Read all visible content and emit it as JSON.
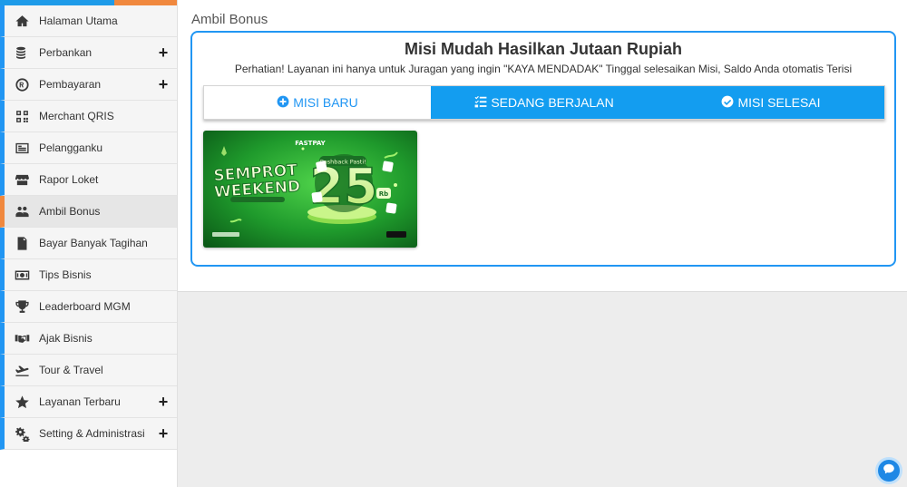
{
  "colors": {
    "accent": "#2196f3",
    "active_marker": "#f0883e",
    "tab_active_bg": "#139df0",
    "banner_green": "#1f9a2c"
  },
  "sidebar": {
    "items": [
      {
        "label": "Halaman Utama",
        "icon": "home-icon",
        "expandable": false,
        "active": false
      },
      {
        "label": "Perbankan",
        "icon": "coins-icon",
        "expandable": true,
        "active": false
      },
      {
        "label": "Pembayaran",
        "icon": "rupiah-coin-icon",
        "expandable": true,
        "active": false
      },
      {
        "label": "Merchant QRIS",
        "icon": "qr-code-icon",
        "expandable": false,
        "active": false
      },
      {
        "label": "Pelangganku",
        "icon": "address-card-icon",
        "expandable": false,
        "active": false
      },
      {
        "label": "Rapor Loket",
        "icon": "store-icon",
        "expandable": false,
        "active": false
      },
      {
        "label": "Ambil Bonus",
        "icon": "users-icon",
        "expandable": false,
        "active": true
      },
      {
        "label": "Bayar Banyak Tagihan",
        "icon": "file-invoice-icon",
        "expandable": false,
        "active": false
      },
      {
        "label": "Tips Bisnis",
        "icon": "money-bill-icon",
        "expandable": false,
        "active": false
      },
      {
        "label": "Leaderboard MGM",
        "icon": "trophy-icon",
        "expandable": false,
        "active": false
      },
      {
        "label": "Ajak Bisnis",
        "icon": "handshake-icon",
        "expandable": false,
        "active": false
      },
      {
        "label": "Tour & Travel",
        "icon": "plane-departure-icon",
        "expandable": false,
        "active": false
      },
      {
        "label": "Layanan Terbaru",
        "icon": "star-icon",
        "expandable": true,
        "active": false
      },
      {
        "label": "Setting & Administrasi",
        "icon": "gears-icon",
        "expandable": true,
        "active": false
      }
    ],
    "plus_symbol": "+"
  },
  "main": {
    "page_title": "Ambil Bonus",
    "card": {
      "title": "Misi Mudah Hasilkan Jutaan Rupiah",
      "subtitle": "Perhatian! Layanan ini hanya untuk Juragan yang ingin \"KAYA MENDADAK\" Tinggal selesaikan Misi, Saldo Anda otomatis Terisi"
    },
    "tabs": [
      {
        "label": "MISI BARU",
        "icon": "plus-circle-icon",
        "active": false
      },
      {
        "label": "SEDANG BERJALAN",
        "icon": "list-check-icon",
        "active": true
      },
      {
        "label": "MISI SELESAI",
        "icon": "check-circle-icon",
        "active": true
      }
    ],
    "banner": {
      "brand": "FASTPAY",
      "headline_line1": "SEMPROT",
      "headline_line2": "WEEKEND",
      "tagline": "Cashback Pasti!",
      "amount": "25",
      "amount_unit": "Rb"
    }
  }
}
